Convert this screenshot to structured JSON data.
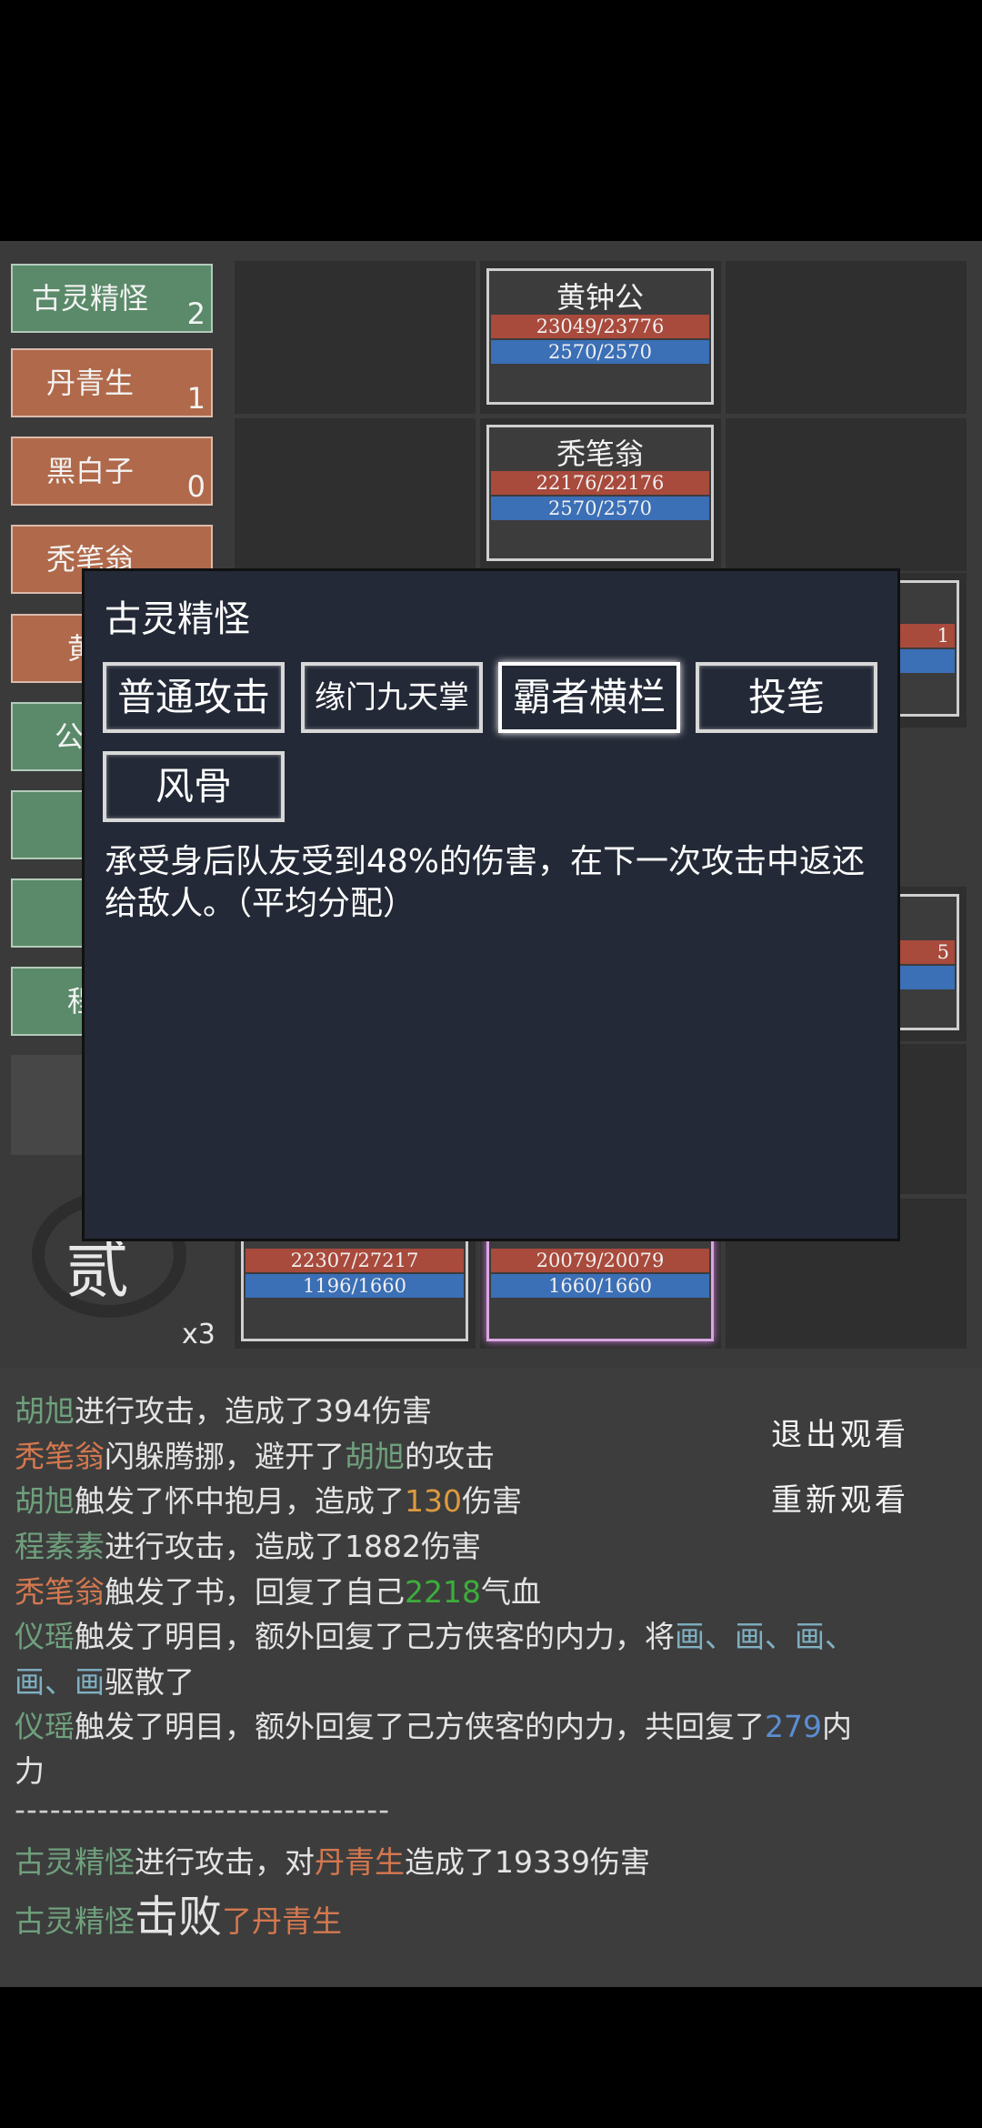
{
  "roster": [
    {
      "name": "古灵精怪",
      "count": "2",
      "color": "green"
    },
    {
      "name": "丹青生",
      "count": "1",
      "color": "orange"
    },
    {
      "name": "黑白子",
      "count": "0",
      "color": "orange"
    }
  ],
  "roster_partial": [
    "秃笔翁",
    "黄",
    "公",
    "程"
  ],
  "enemy_cards": [
    {
      "name": "黄钟公",
      "hp": "23049/23776",
      "mp": "2570/2570"
    },
    {
      "name": "秃笔翁",
      "hp": "22176/22176",
      "mp": "2570/2570"
    }
  ],
  "bottom_cards": [
    {
      "hp": "22307/27217",
      "mp": "1196/1660"
    },
    {
      "hp": "20079/20079",
      "mp": "1660/1660"
    }
  ],
  "partial_right": {
    "a": "1",
    "b": "5"
  },
  "round": {
    "glyph": "贰",
    "speed": "x3"
  },
  "dialog": {
    "title": "古灵精怪",
    "skills": [
      "普通攻击",
      "缘门九天掌",
      "霸者横栏",
      "投笔",
      "风骨"
    ],
    "selected_index": 2,
    "description": "承受身后队友受到48%的伤害，在下一次攻击中返还给敌人。（平均分配）"
  },
  "side_buttons": {
    "exit": "退出观看",
    "replay": "重新观看"
  },
  "log": {
    "l1": {
      "a": "胡旭",
      "b": "进行攻击，造成了394伤害"
    },
    "l2": {
      "a": "秃笔翁",
      "b": "闪躲腾挪，避开了",
      "c": "胡旭",
      "d": "的攻击"
    },
    "l3": {
      "a": "胡旭",
      "b": "触发了怀中抱月，造成了",
      "c": "130",
      "d": "伤害"
    },
    "l4": {
      "a": "程素素",
      "b": "进行攻击，造成了1882伤害"
    },
    "l5": {
      "a": "秃笔翁",
      "b": "触发了书，回复了自己",
      "c": "2218",
      "d": "气血"
    },
    "l6": {
      "a": "仪瑶",
      "b": "触发了明目，额外回复了己方侠客的内力，将",
      "c1": "画",
      "s1": "、",
      "c2": "画",
      "s2": "、",
      "c3": "画",
      "s3": "、"
    },
    "l7": {
      "c4": "画",
      "s4": "、",
      "c5": "画",
      "b": "驱散了"
    },
    "l8": {
      "a": "仪瑶",
      "b": "触发了明目，额外回复了己方侠客的内力，共回复了",
      "c": "279",
      "d": "内"
    },
    "l9": {
      "d": "力"
    },
    "divider": "--------------------------------",
    "l10": {
      "a": "古灵精怪",
      "b": "进行攻击，对",
      "c": "丹青生",
      "d": "造成了19339伤害"
    },
    "l11": {
      "a": "古灵精怪",
      "b": "击败",
      "c": "了",
      "d": "丹青生"
    }
  }
}
